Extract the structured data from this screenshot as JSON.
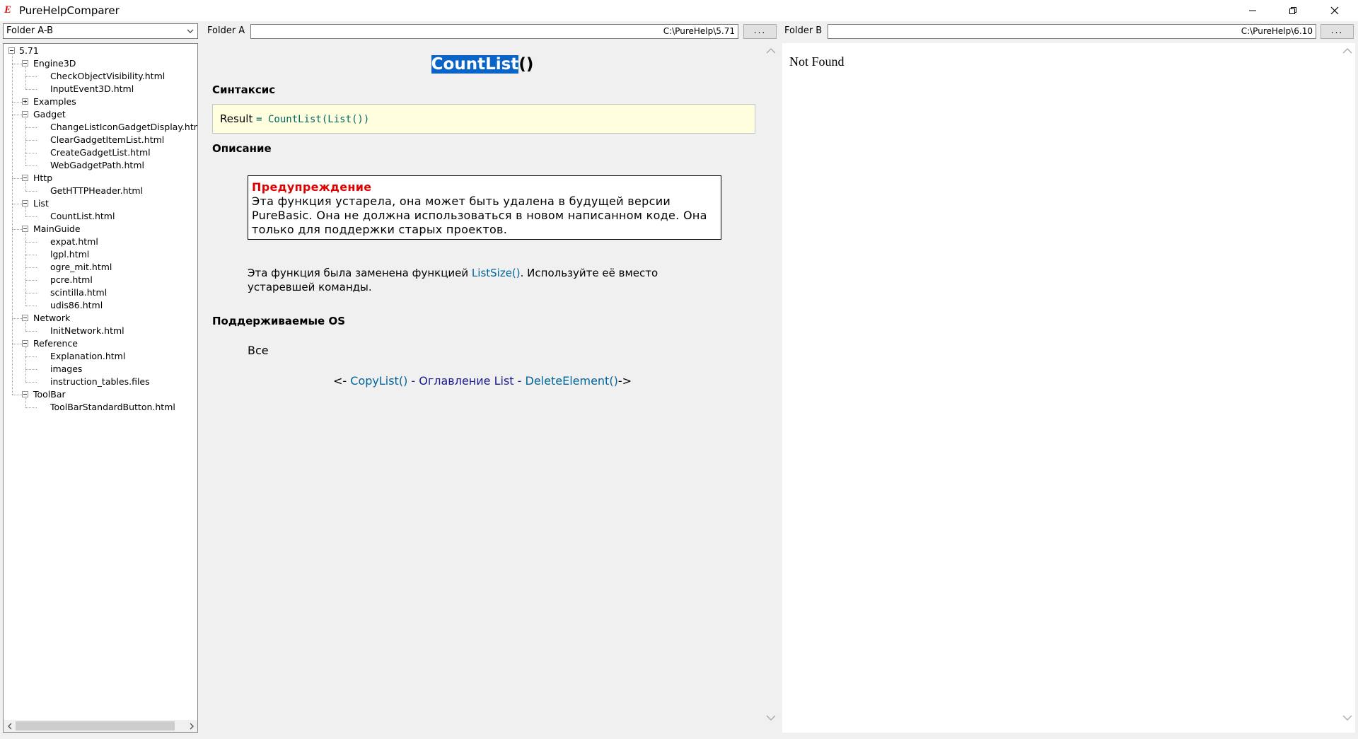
{
  "window": {
    "title": "PureHelpComparer"
  },
  "toolbar": {
    "mode_select": "Folder A-B",
    "folder_a_label": "Folder A",
    "folder_a_path": "C:\\PureHelp\\5.71",
    "folder_b_label": "Folder B",
    "folder_b_path": "C:\\PureHelp\\6.10",
    "browse_label": "..."
  },
  "tree": {
    "root": "5.71",
    "groups": [
      {
        "label": "Engine3D",
        "expanded": true,
        "children": [
          "CheckObjectVisibility.html",
          "InputEvent3D.html"
        ]
      },
      {
        "label": "Examples",
        "expanded": false,
        "children": []
      },
      {
        "label": "Gadget",
        "expanded": true,
        "children": [
          "ChangeListIconGadgetDisplay.html",
          "ClearGadgetItemList.html",
          "CreateGadgetList.html",
          "WebGadgetPath.html"
        ]
      },
      {
        "label": "Http",
        "expanded": true,
        "children": [
          "GetHTTPHeader.html"
        ]
      },
      {
        "label": "List",
        "expanded": true,
        "children": [
          "CountList.html"
        ]
      },
      {
        "label": "MainGuide",
        "expanded": true,
        "children": [
          "expat.html",
          "lgpl.html",
          "ogre_mit.html",
          "pcre.html",
          "scintilla.html",
          "udis86.html"
        ]
      },
      {
        "label": "Network",
        "expanded": true,
        "children": [
          "InitNetwork.html"
        ]
      },
      {
        "label": "Reference",
        "expanded": true,
        "children": [
          "Explanation.html",
          "images",
          "instruction_tables.files"
        ]
      },
      {
        "label": "ToolBar",
        "expanded": true,
        "children": [
          "ToolBarStandardButton.html"
        ]
      }
    ]
  },
  "doc_a": {
    "title_selected": "CountList",
    "title_rest": "()",
    "syntax_heading": "Синтаксис",
    "syntax_result": "Result",
    "syntax_code": "= CountList(List())",
    "description_heading": "Описание",
    "warning_title": "Предупреждение",
    "warning_text": "Эта функция устарела, она может быть удалена в будущей версии PureBasic. Она не должна использоваться в новом написанном коде. Она только для поддержки старых проектов.",
    "replaced_before": "Эта функция была заменена функцией ",
    "replaced_link": "ListSize()",
    "replaced_after": ". Используйте её вместо устаревшей команды.",
    "os_heading": "Поддерживаемые OS",
    "os_value": "Все",
    "nav_prev_prefix": "<- ",
    "nav_prev": "CopyList()",
    "nav_sep1": " - ",
    "nav_toc": "Оглавление List",
    "nav_sep2": " - ",
    "nav_next": "DeleteElement()",
    "nav_next_suffix": "->"
  },
  "doc_b": {
    "text": "Not Found"
  }
}
